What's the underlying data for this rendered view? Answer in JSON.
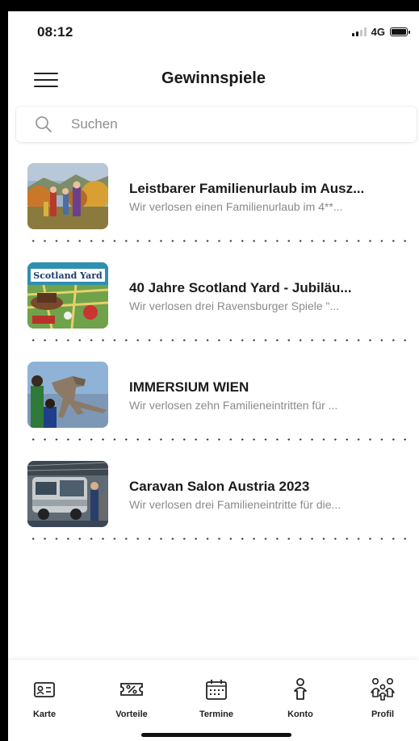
{
  "status_bar": {
    "time": "08:12",
    "network": "4G"
  },
  "header": {
    "title": "Gewinnspiele"
  },
  "search": {
    "placeholder": "Suchen"
  },
  "items": [
    {
      "title": "Leistbarer Familienurlaub im Ausz...",
      "subtitle": "Wir verlosen einen Familienurlaub im 4**...",
      "image": "family-autumn-photo"
    },
    {
      "title": "40 Jahre Scotland Yard - Jubiläu...",
      "subtitle": "Wir verlosen drei Ravensburger Spiele \"...",
      "image": "scotland-yard-board-game-photo"
    },
    {
      "title": "IMMERSIUM WIEN",
      "subtitle": "Wir verlosen zehn Familieneintritten für ...",
      "image": "dinosaur-exhibit-photo"
    },
    {
      "title": "Caravan Salon Austria 2023",
      "subtitle": "Wir verlosen drei Familieneintritte für die...",
      "image": "caravan-photo"
    }
  ],
  "thumbnail_text": {
    "scotland_yard_logo": "Scotland Yard"
  },
  "tabbar": [
    {
      "label": "Karte",
      "icon": "id-card-icon"
    },
    {
      "label": "Vorteile",
      "icon": "ticket-percent-icon"
    },
    {
      "label": "Termine",
      "icon": "calendar-icon"
    },
    {
      "label": "Konto",
      "icon": "person-icon"
    },
    {
      "label": "Profil",
      "icon": "family-icon"
    }
  ],
  "colors": {
    "background": "#ffffff",
    "text": "#1b1b1b",
    "subtext": "#8a8a8a"
  }
}
